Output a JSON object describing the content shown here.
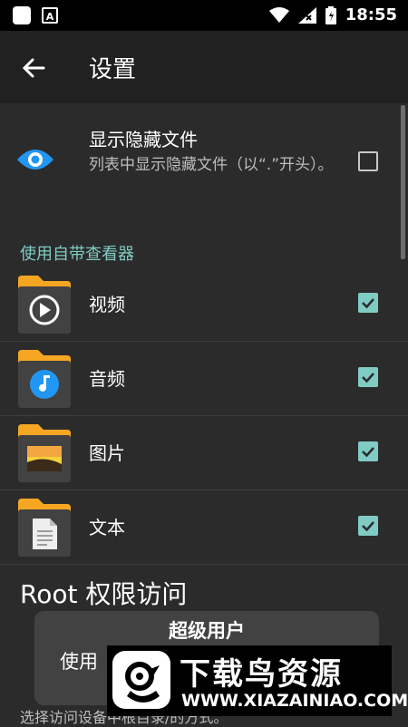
{
  "status_bar": {
    "time": "18:55",
    "app_icon_letter": "A"
  },
  "toolbar": {
    "title": "设置"
  },
  "hidden_files": {
    "title": "显示隐藏文件",
    "subtitle": "列表中显示隐藏文件（以“.”开头）。",
    "checked": false
  },
  "viewer_section": {
    "header": "使用自带查看器"
  },
  "viewers": [
    {
      "label": "视频",
      "icon": "video-folder-icon",
      "checked": true
    },
    {
      "label": "音频",
      "icon": "audio-folder-icon",
      "checked": true
    },
    {
      "label": "图片",
      "icon": "image-folder-icon",
      "checked": true
    },
    {
      "label": "文本",
      "icon": "text-folder-icon",
      "checked": true
    }
  ],
  "root": {
    "title": "Root 权限访问",
    "card_title": "超级用户",
    "card_text": "使用",
    "description": "选择访问设备中根目录/的方式。"
  },
  "watermark": {
    "name": "下载鸟资源",
    "url": "WWW.XIAZAINIAO.COM"
  },
  "colors": {
    "accent": "#80cbc4",
    "background": "#2b2b2b",
    "toolbar": "#212121",
    "folder": "#f5a623"
  }
}
